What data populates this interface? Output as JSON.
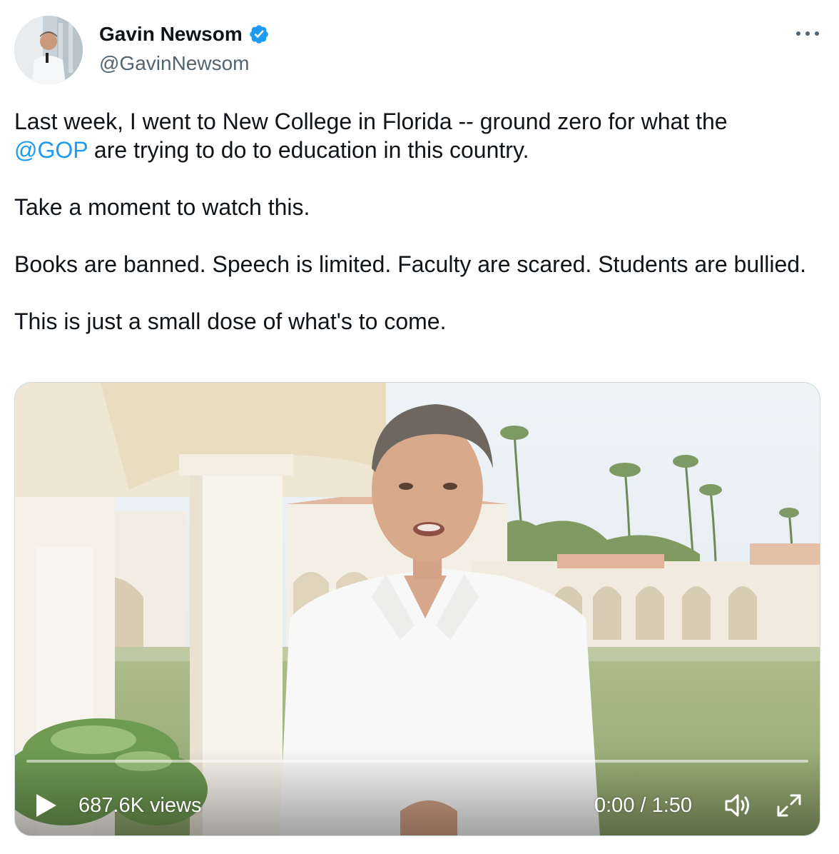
{
  "author": {
    "name": "Gavin Newsom",
    "handle": "@GavinNewsom",
    "verified": true,
    "avatar_icon": "profile-photo"
  },
  "tweet": {
    "line1_before": "Last week, I went to New College in Florida -- ground zero for what the",
    "mention": "@GOP",
    "line1_after": " are trying to do to education in this country.",
    "paragraph2": "Take a moment to watch this.",
    "paragraph3": "Books are banned. Speech is limited. Faculty are scared. Students are bullied.",
    "paragraph4": "This is just a small dose of what's to come."
  },
  "video": {
    "views": "687.6K views",
    "time": "0:00 / 1:50",
    "progress": 0,
    "play_icon": "play-icon",
    "volume_icon": "volume-icon",
    "expand_icon": "fullscreen-icon"
  },
  "colors": {
    "accent": "#1d9bf0",
    "text": "#0f1419",
    "secondary": "#536471",
    "verified": "#1d9bf0"
  },
  "menu_icon": "more-options-icon"
}
